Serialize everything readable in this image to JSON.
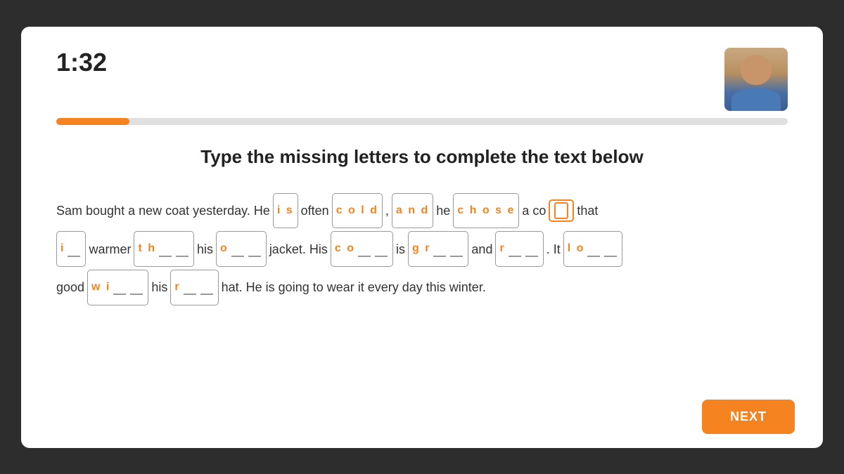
{
  "timer": "1:32",
  "progress_percent": 10,
  "instruction": "Type the missing letters to complete the text below",
  "next_button_label": "NEXT",
  "sentence_line1_prefix": "Sam bought a new coat yesterday. He",
  "sentence_line1_middle1": "often",
  "sentence_line1_middle2": ",",
  "sentence_line1_middle3": "he",
  "sentence_line1_middle4": "a co",
  "sentence_line1_suffix": "that",
  "sentence_line2_prefix1": "",
  "sentence_line2_warmer": "warmer",
  "sentence_line2_his1": "his",
  "sentence_line2_jacket": "jacket. His",
  "sentence_line2_is": "is",
  "sentence_line2_and": "and",
  "sentence_line2_it": ". It",
  "sentence_line3_good": "good",
  "sentence_line3_his2": "his",
  "sentence_line3_hat": "hat. He is going to wear it every day this winter."
}
